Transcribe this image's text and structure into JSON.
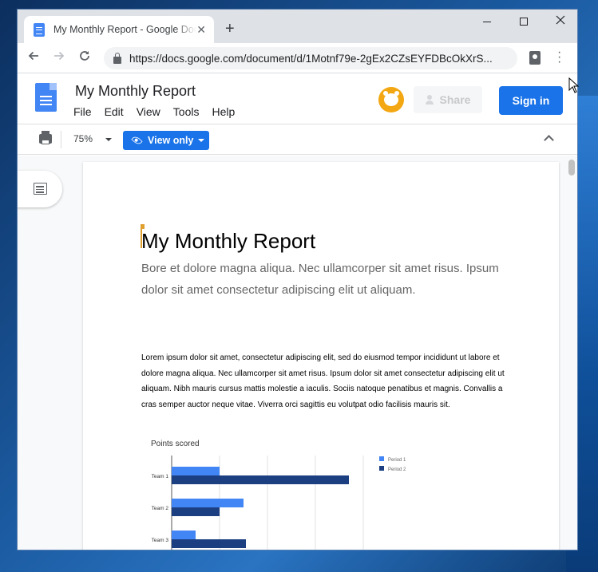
{
  "browser": {
    "tab_title": "My Monthly Report - Google Docs",
    "tab_close": "✕",
    "new_tab": "+",
    "url": "https://docs.google.com/document/d/1Motnf79e-2gEx2CZsEYFDBcOkXrS..."
  },
  "docs": {
    "title": "My Monthly Report",
    "menu": [
      "File",
      "Edit",
      "View",
      "Tools",
      "Help"
    ],
    "share_label": "Share",
    "signin_label": "Sign in",
    "zoom": "75%",
    "view_only_label": "View only"
  },
  "document": {
    "heading": "My Monthly Report",
    "subtitle": "Bore et dolore magna aliqua. Nec ullamcorper sit amet risus. Ipsum dolor sit amet consectetur adipiscing elit ut aliquam.",
    "body": "Lorem ipsum dolor sit amet, consectetur adipiscing elit, sed do eiusmod tempor incididunt ut labore et dolore magna aliqua. Nec ullamcorper sit amet risus. Ipsum dolor sit amet consectetur adipiscing elit ut aliquam. Nibh mauris cursus mattis molestie a iaculis. Sociis natoque penatibus et magnis. Convallis a cras semper auctor neque vitae. Viverra orci sagittis eu volutpat odio facilisis mauris sit."
  },
  "colors": {
    "accent": "#1a73e8",
    "period1": "#4285f4",
    "period2": "#1c3f82"
  },
  "chart_data": {
    "type": "bar",
    "orientation": "horizontal",
    "title": "Points scored",
    "categories": [
      "Team 1",
      "Team 2",
      "Team 3"
    ],
    "series": [
      {
        "name": "Period 1",
        "values": [
          10,
          15,
          5
        ]
      },
      {
        "name": "Period 2",
        "values": [
          37,
          10,
          15.5
        ]
      }
    ],
    "xlim": [
      0,
      40
    ],
    "grid": true,
    "legend": "right"
  }
}
